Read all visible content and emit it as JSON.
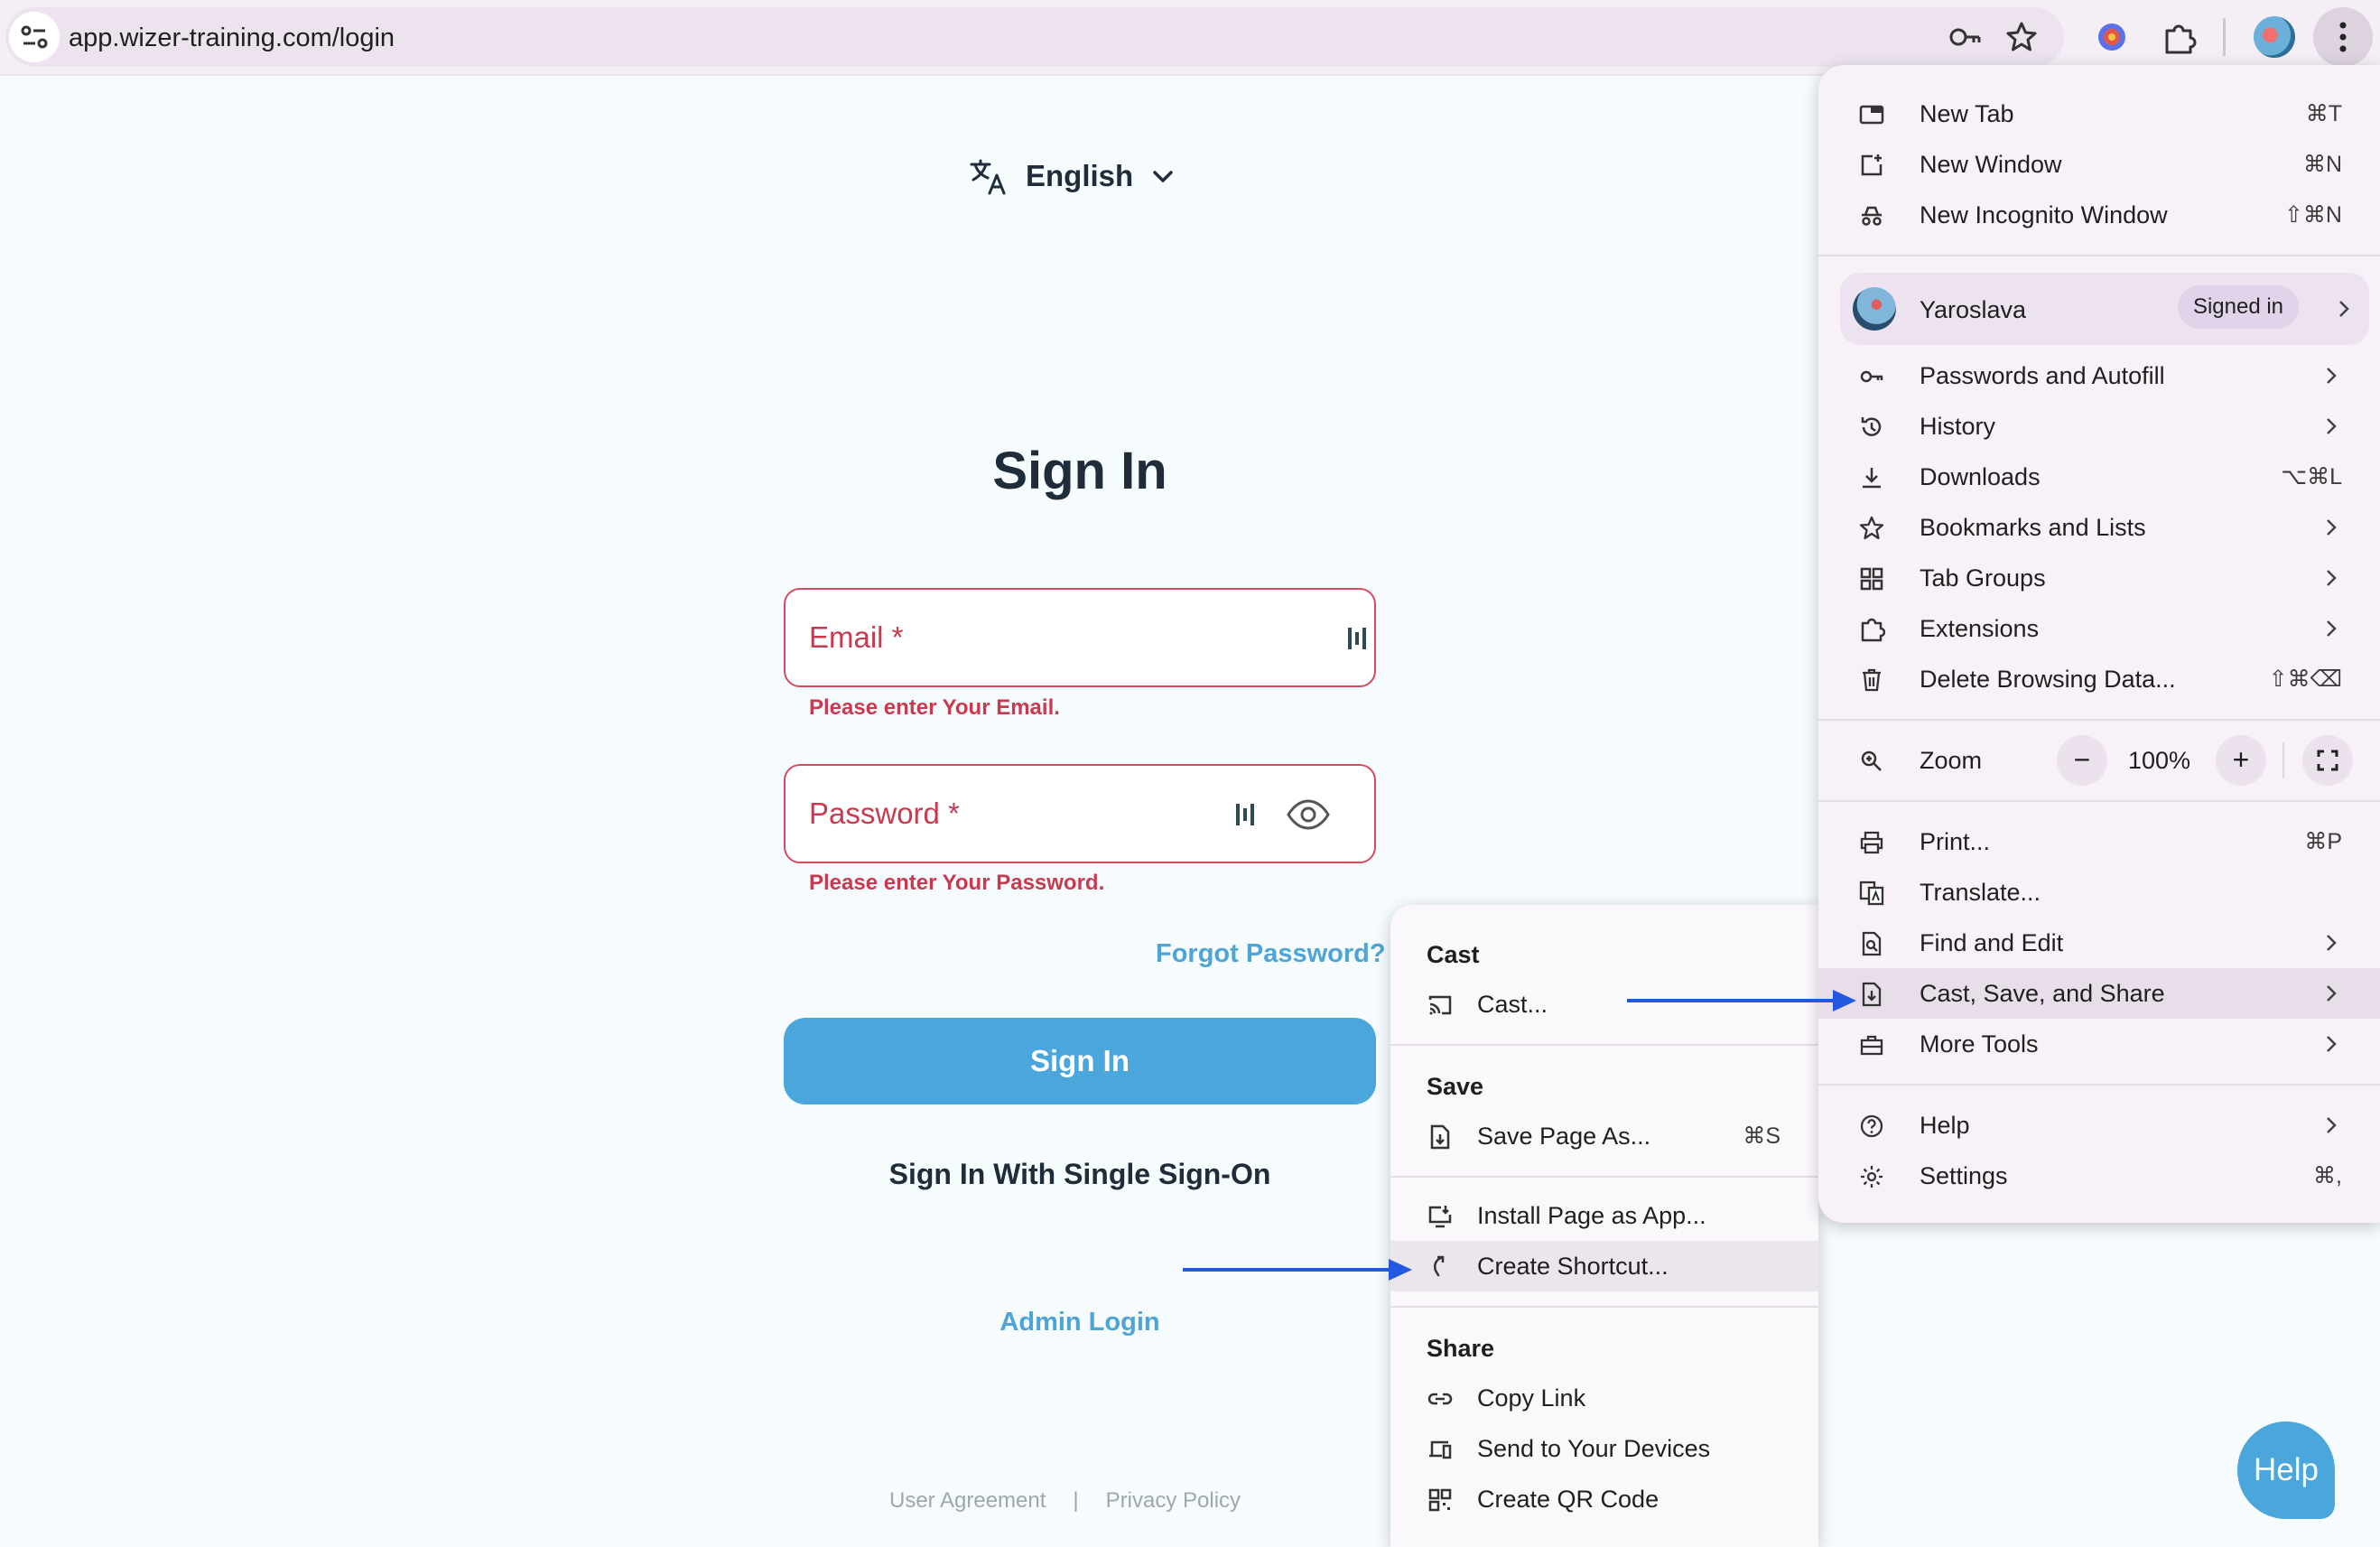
{
  "browser": {
    "url": "app.wizer-training.com/login"
  },
  "page": {
    "language": "English",
    "title": "Sign In",
    "email_label": "Email *",
    "email_error": "Please enter Your Email.",
    "password_label": "Password *",
    "password_error": "Please enter Your Password.",
    "forgot_password": "Forgot Password?",
    "signin_button": "Sign In",
    "sso_link": "Sign In With Single Sign-On",
    "admin_login": "Admin Login",
    "footer": {
      "user_agreement": "User Agreement",
      "divider": "|",
      "privacy_policy": "Privacy Policy"
    },
    "help_button": "Help"
  },
  "menu": {
    "new_tab": {
      "label": "New Tab",
      "shortcut": "⌘T",
      "icon": "new-tab-icon"
    },
    "new_window": {
      "label": "New Window",
      "shortcut": "⌘N",
      "icon": "new-window-icon"
    },
    "new_incognito": {
      "label": "New Incognito Window",
      "shortcut": "⇧⌘N",
      "icon": "incognito-icon"
    },
    "profile": {
      "name": "Yaroslava",
      "status": "Signed in"
    },
    "passwords": {
      "label": "Passwords and Autofill",
      "icon": "key-icon"
    },
    "history": {
      "label": "History",
      "icon": "history-icon"
    },
    "downloads": {
      "label": "Downloads",
      "shortcut": "⌥⌘L",
      "icon": "download-icon"
    },
    "bookmarks": {
      "label": "Bookmarks and Lists",
      "icon": "star-icon"
    },
    "tab_groups": {
      "label": "Tab Groups",
      "icon": "tab-groups-icon"
    },
    "extensions": {
      "label": "Extensions",
      "icon": "puzzle-icon"
    },
    "delete_data": {
      "label": "Delete Browsing Data...",
      "shortcut": "⇧⌘⌫",
      "icon": "trash-icon"
    },
    "zoom": {
      "label": "Zoom",
      "value": "100%",
      "minus": "−",
      "plus": "+"
    },
    "print": {
      "label": "Print...",
      "shortcut": "⌘P",
      "icon": "printer-icon"
    },
    "translate": {
      "label": "Translate...",
      "icon": "translate-icon"
    },
    "find_edit": {
      "label": "Find and Edit",
      "icon": "find-icon"
    },
    "cast_save_share": {
      "label": "Cast, Save, and Share",
      "icon": "cast-save-icon"
    },
    "more_tools": {
      "label": "More Tools",
      "icon": "toolbox-icon"
    },
    "help": {
      "label": "Help",
      "icon": "help-icon"
    },
    "settings": {
      "label": "Settings",
      "shortcut": "⌘,",
      "icon": "gear-icon"
    }
  },
  "submenu": {
    "cast_header": "Cast",
    "cast_item": "Cast...",
    "save_header": "Save",
    "save_page": {
      "label": "Save Page As...",
      "shortcut": "⌘S"
    },
    "install_app": "Install Page as App...",
    "create_shortcut": "Create Shortcut...",
    "share_header": "Share",
    "copy_link": "Copy Link",
    "send_devices": "Send to Your Devices",
    "qr_code": "Create QR Code"
  },
  "colors": {
    "accent": "#4aa6db",
    "error": "#c93a4f",
    "annotation_arrow": "#2358e0"
  }
}
